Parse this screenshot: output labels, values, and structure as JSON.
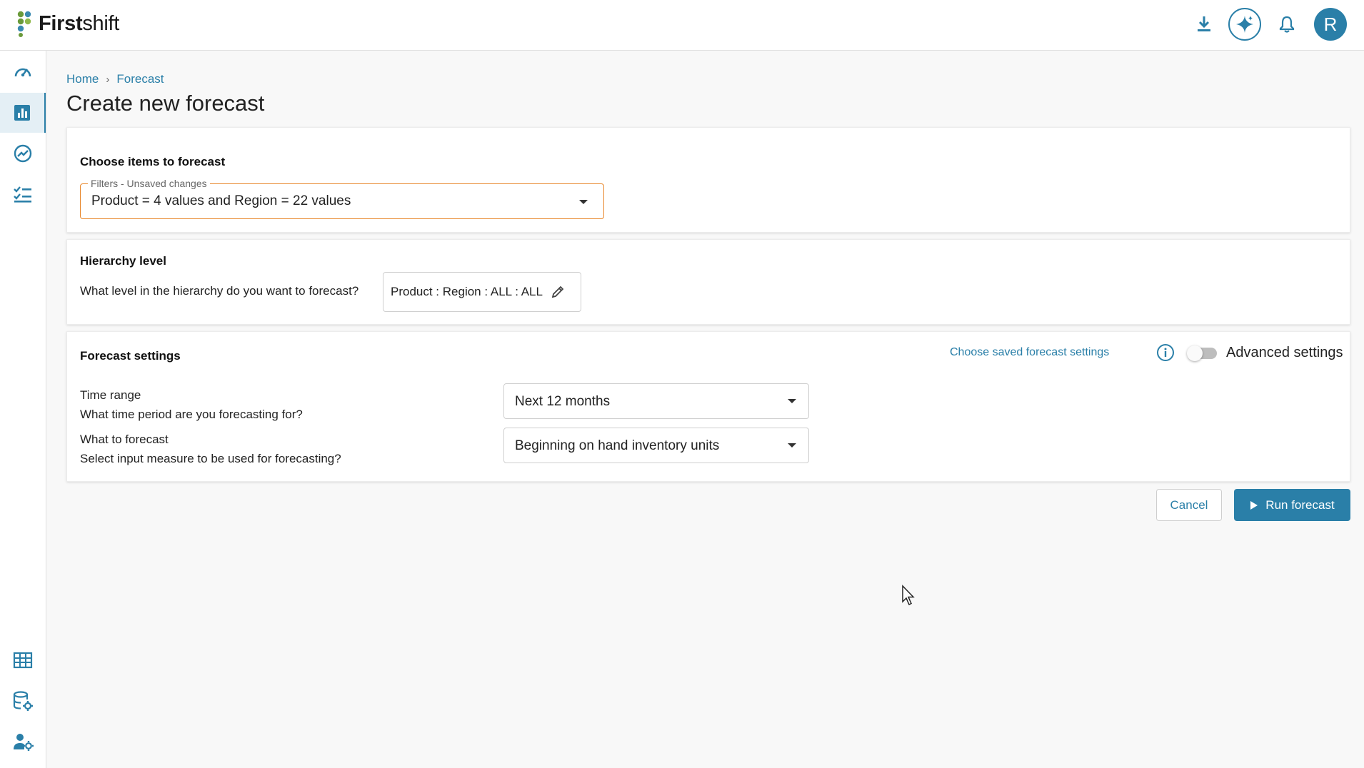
{
  "app": {
    "brand_bold": "First",
    "brand_light": "shift"
  },
  "breadcrumb": {
    "home": "Home",
    "current": "Forecast"
  },
  "page_title": "Create new forecast",
  "user": {
    "avatar_initial": "R"
  },
  "items_section": {
    "title": "Choose items to forecast",
    "filter_legend": "Filters - Unsaved changes",
    "filter_value": "Product = 4 values and Region = 22 values"
  },
  "hierarchy_section": {
    "title": "Hierarchy level",
    "question": "What level in the hierarchy do you want to forecast?",
    "value": "Product : Region : ALL : ALL"
  },
  "settings_section": {
    "title": "Forecast settings",
    "saved_link": "Choose saved forecast settings",
    "advanced_label": "Advanced settings",
    "advanced_enabled": false,
    "time_range": {
      "label": "Time range",
      "question": "What time period are you forecasting for?",
      "value": "Next 12 months"
    },
    "what_to_forecast": {
      "label": "What to forecast",
      "question": "Select input measure to be used for forecasting?",
      "value": "Beginning on hand inventory units"
    }
  },
  "actions": {
    "cancel": "Cancel",
    "run": "Run forecast"
  },
  "icons": {
    "top": [
      "download-icon",
      "ai-sparkle-icon",
      "bell-icon"
    ],
    "sidebar": [
      "dashboard-gauge-icon",
      "bar-chart-icon",
      "trend-icon",
      "checklist-icon",
      "table-grid-icon",
      "database-settings-icon",
      "user-settings-icon"
    ]
  },
  "colors": {
    "accent": "#2a7fa8",
    "warning_border": "#e8862a",
    "logo_green": "#6a9a3a"
  }
}
